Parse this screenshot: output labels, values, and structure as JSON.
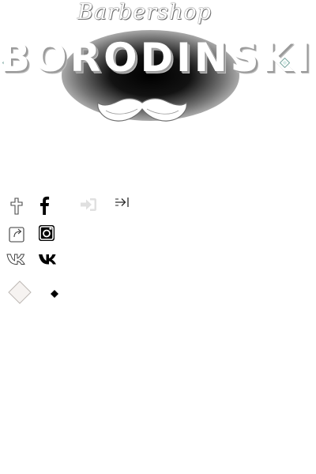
{
  "logo": {
    "script_text": "Barbershop",
    "wordmark": "BORODINSKI"
  },
  "icons": [
    "cross-icon",
    "facebook-icon",
    "sign-in-icon",
    "arrow-right-icon",
    "share-icon",
    "instagram-icon",
    "vk-icon",
    "diamond-icon"
  ],
  "colors": {
    "background": "#ffffff",
    "glyph_dark": "#000000",
    "glyph_light": "#e5e5e5"
  }
}
